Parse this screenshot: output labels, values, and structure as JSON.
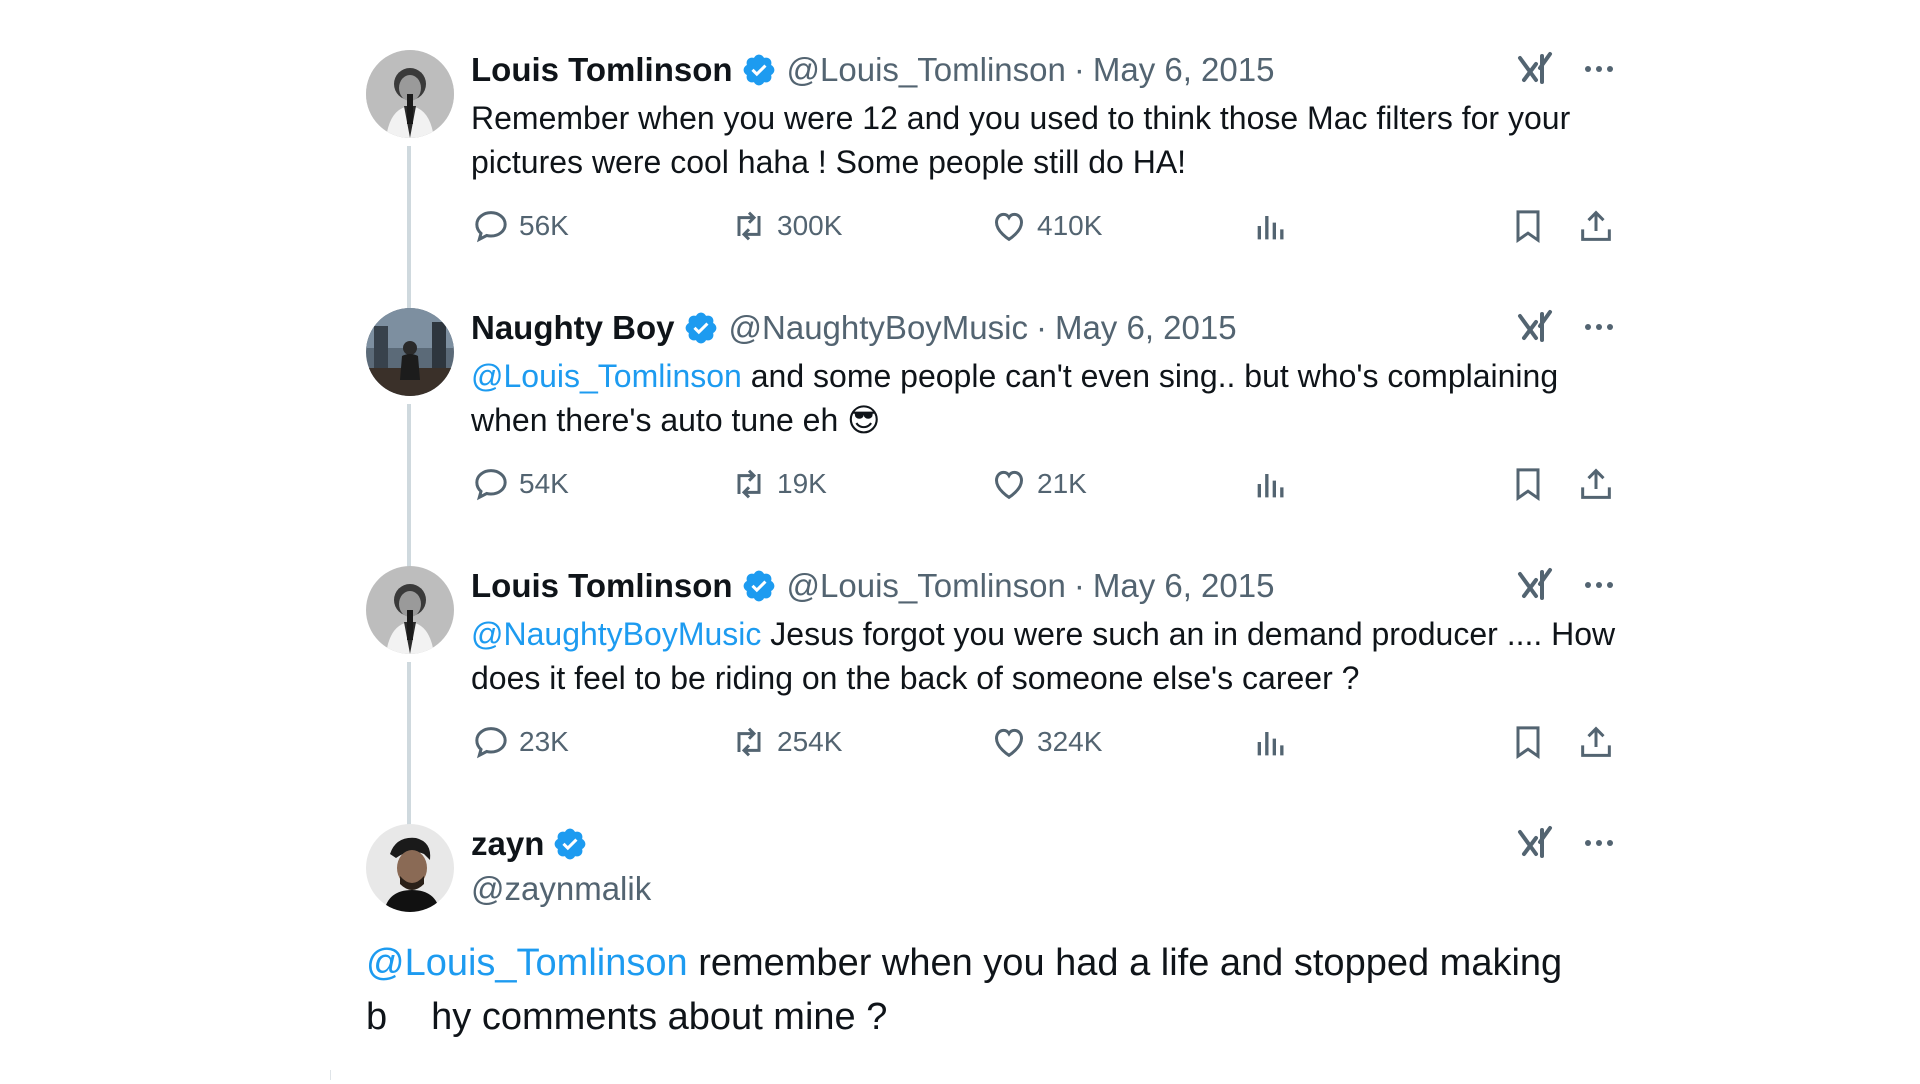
{
  "tweets": [
    {
      "name": "Louis Tomlinson",
      "handle": "@Louis_Tomlinson",
      "separator": "·",
      "date": "May 6, 2015",
      "mention": "",
      "text": "Remember when you were 12 and you used to think those Mac filters for your pictures were cool haha ! Some people still do HA!",
      "replies": "56K",
      "retweets": "300K",
      "likes": "410K"
    },
    {
      "name": "Naughty Boy",
      "handle": "@NaughtyBoyMusic",
      "separator": "·",
      "date": "May 6, 2015",
      "mention": "@Louis_Tomlinson",
      "text": " and some people can't even sing.. but who's complaining when there's auto tune eh 😎",
      "replies": "54K",
      "retweets": "19K",
      "likes": "21K"
    },
    {
      "name": "Louis Tomlinson",
      "handle": "@Louis_Tomlinson",
      "separator": "·",
      "date": "May 6, 2015",
      "mention": "@NaughtyBoyMusic",
      "text": " Jesus forgot you were such an in demand producer .... How does it feel to be riding on the back of someone else's career ?",
      "replies": "23K",
      "retweets": "254K",
      "likes": "324K"
    }
  ],
  "main_tweet": {
    "name": "zayn",
    "handle": "@zaynmalik",
    "mention": "@Louis_Tomlinson",
    "text_line1": " remember when you had a life and stopped making",
    "text_line2_start": "b",
    "text_line2_rest": "hy comments about mine ?"
  },
  "icons": {
    "verified": "verified-badge-icon",
    "grok": "grok-icon",
    "more": "more-dots-icon",
    "reply": "reply-icon",
    "retweet": "retweet-icon",
    "like": "heart-icon",
    "views": "views-chart-icon",
    "bookmark": "bookmark-icon",
    "share": "share-icon"
  },
  "colors": {
    "link": "#1d9bf0",
    "secondary_text": "#536471",
    "thread_line": "#cfd9de",
    "verified": "#1d9bf0"
  }
}
